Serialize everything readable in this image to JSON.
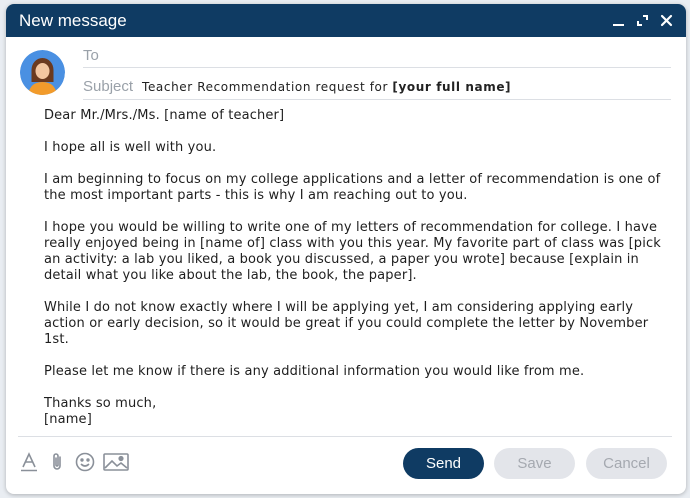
{
  "window": {
    "title": "New message"
  },
  "fields": {
    "to_label": "To",
    "to_value": "",
    "subject_label": "Subject",
    "subject_prefix": "Teacher Recommendation request for ",
    "subject_bold": "[your full name]"
  },
  "body": {
    "greeting": "Dear Mr./Mrs./Ms. [name of teacher]",
    "paragraph_1": "I hope all is well with you.",
    "paragraph_2": "I am beginning to focus on my college applications and a letter of recommendation is one of the most important parts - this is why I am reaching out to you.",
    "paragraph_3": "I hope you would be willing to write one of my letters of recommendation for college. I have really enjoyed being in [name of] class with you this year. My favorite part of class was [pick an activity: a lab you liked, a book you discussed, a paper you wrote] because [explain in detail what you like about the lab, the book, the paper].",
    "paragraph_4": "While I do not know exactly where I will be applying yet, I am considering applying early action or early decision, so it would be great if you could complete the letter by November 1st.",
    "paragraph_5": "Please let me know if there is any additional information you would like from me.",
    "closing": "Thanks so much,",
    "signature": "[name]"
  },
  "toolbar": {
    "icons": [
      "text-format-icon",
      "paperclip-icon",
      "emoji-icon",
      "image-icon"
    ]
  },
  "actions": {
    "send_label": "Send",
    "save_label": "Save",
    "cancel_label": "Cancel"
  },
  "colors": {
    "header": "#0f3b63",
    "send_button": "#0f3b63",
    "disabled_button": "#e3e5ea",
    "avatar_bg": "#4a90e2",
    "avatar_shirt": "#f29b2b"
  }
}
